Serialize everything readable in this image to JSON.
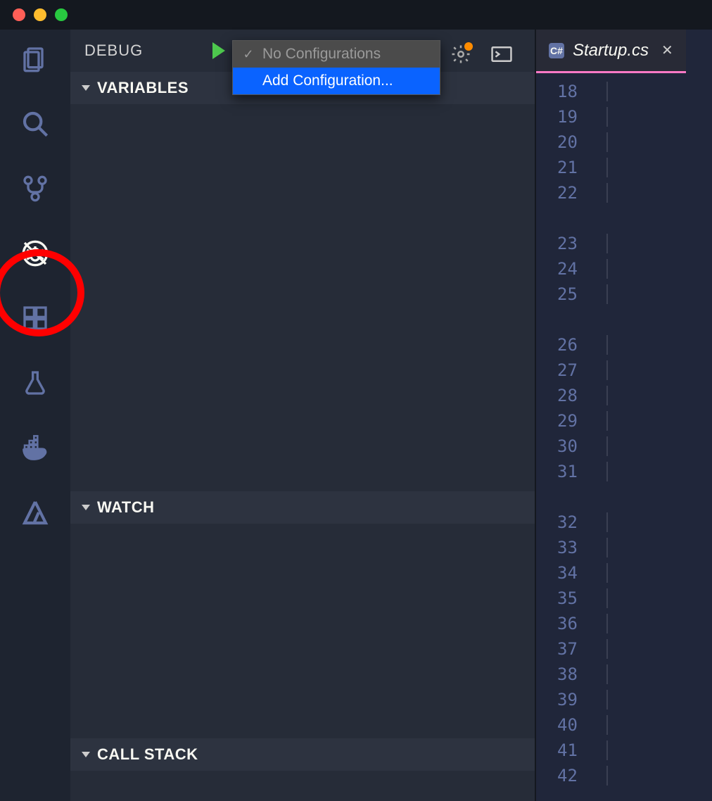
{
  "window": {
    "traffic": [
      "close",
      "minimize",
      "zoom"
    ]
  },
  "activitybar": {
    "items": [
      {
        "name": "explorer-icon"
      },
      {
        "name": "search-icon"
      },
      {
        "name": "source-control-icon"
      },
      {
        "name": "debug-icon",
        "active": true,
        "highlighted": true
      },
      {
        "name": "extensions-icon"
      },
      {
        "name": "test-icon"
      },
      {
        "name": "docker-icon"
      },
      {
        "name": "azure-icon"
      }
    ]
  },
  "debug": {
    "title": "DEBUG",
    "dropdown": {
      "selected": "No Configurations",
      "highlighted": "Add Configuration..."
    },
    "hasSettingsBadge": true,
    "sections": [
      {
        "label": "VARIABLES"
      },
      {
        "label": "WATCH"
      },
      {
        "label": "CALL STACK"
      }
    ]
  },
  "editor": {
    "tab": {
      "iconText": "C#",
      "filename": "Startup.cs"
    },
    "lineGroups": [
      [
        18,
        19,
        20,
        21,
        22
      ],
      [
        23,
        24,
        25
      ],
      [
        26,
        27,
        28,
        29,
        30,
        31
      ],
      [
        32,
        33,
        34,
        35,
        36,
        37,
        38,
        39,
        40,
        41,
        42
      ]
    ]
  }
}
